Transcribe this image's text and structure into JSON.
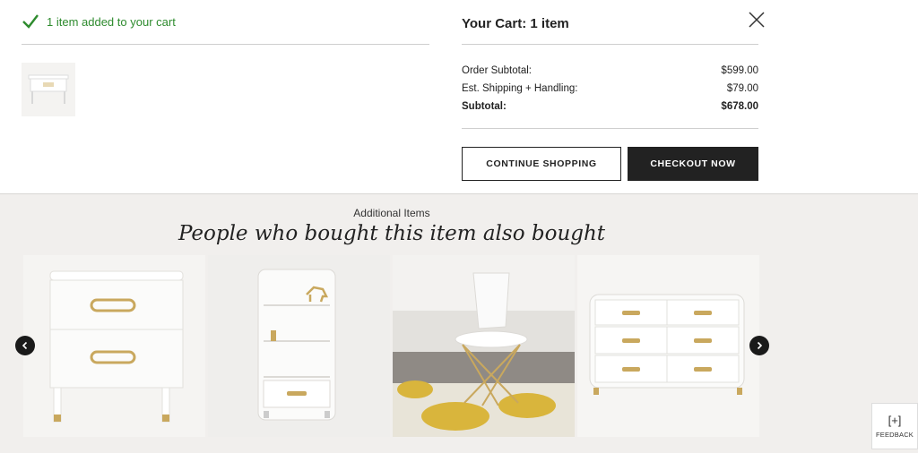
{
  "notification": {
    "text": "1 item added to your cart",
    "color": "#2e8b2e"
  },
  "cart": {
    "title": "Your Cart: 1 item",
    "rows": [
      {
        "label": "Order Subtotal:",
        "value": "$599.00"
      },
      {
        "label": "Est. Shipping + Handling:",
        "value": "$79.00"
      },
      {
        "label": "Subtotal:",
        "value": "$678.00"
      }
    ],
    "continue_label": "CONTINUE SHOPPING",
    "checkout_label": "CHECKOUT NOW"
  },
  "recommendations": {
    "label": "Additional Items",
    "heading": "People who bought this item also bought"
  },
  "feedback": {
    "icon": "[+]",
    "label": "FEEDBACK"
  },
  "colors": {
    "accent": "#222222",
    "success": "#2e8b2e",
    "background": "#f1efed"
  }
}
